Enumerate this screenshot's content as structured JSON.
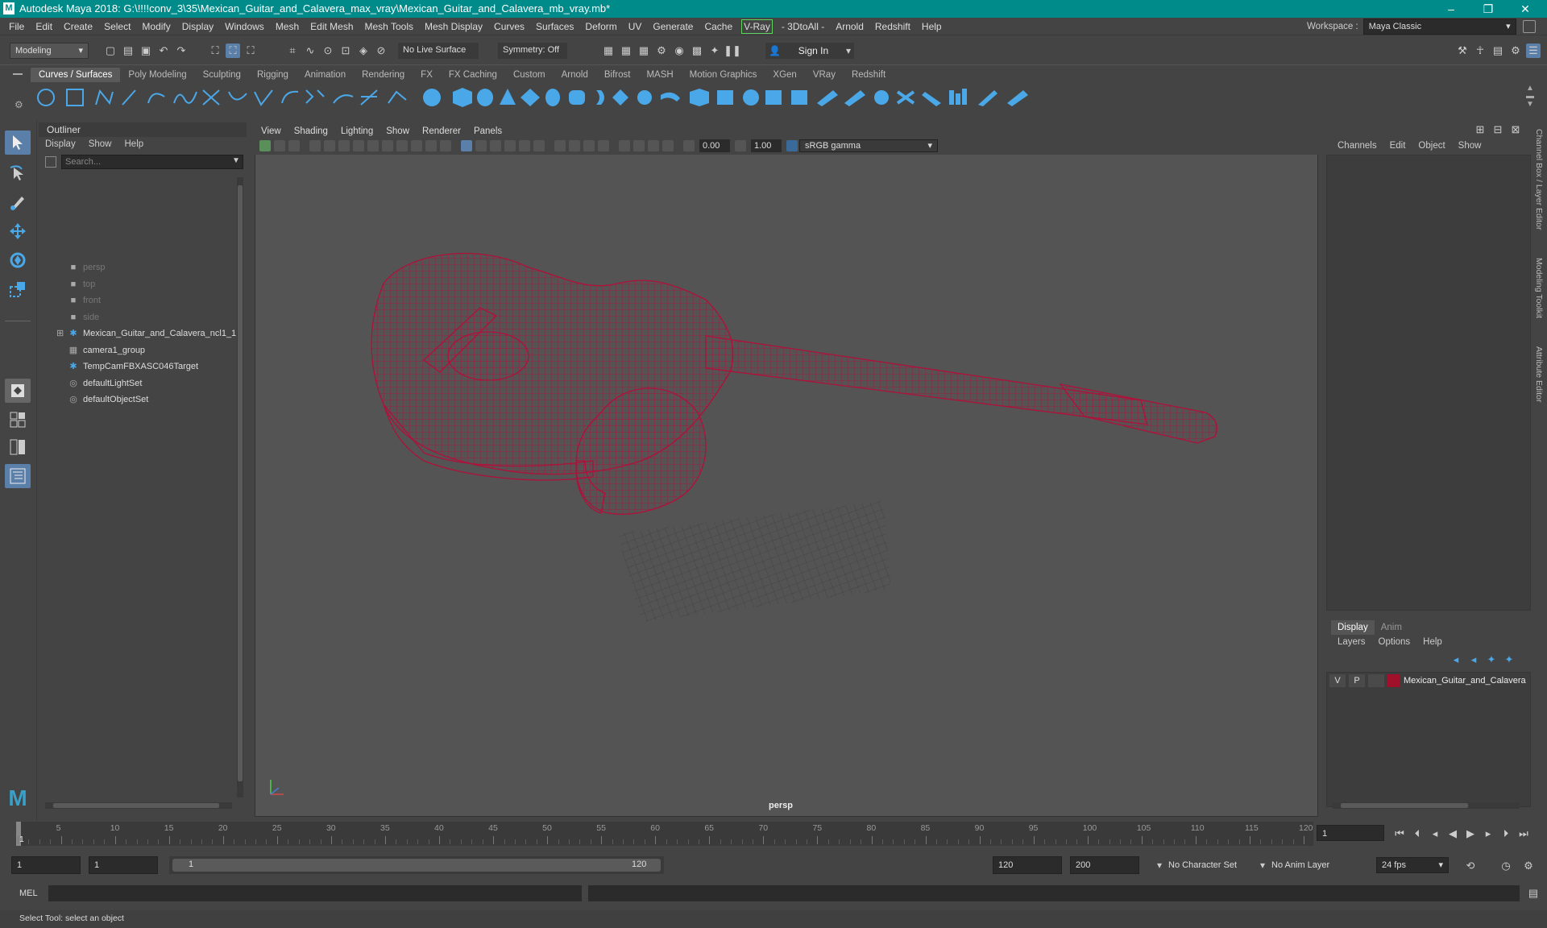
{
  "app": {
    "title": "Autodesk Maya 2018: G:\\!!!!conv_3\\35\\Mexican_Guitar_and_Calavera_max_vray\\Mexican_Guitar_and_Calavera_mb_vray.mb*",
    "logo_text": "M",
    "minimize": "–",
    "restore": "❐",
    "close": "✕"
  },
  "menubar": [
    "File",
    "Edit",
    "Create",
    "Select",
    "Modify",
    "Display",
    "Windows",
    "Mesh",
    "Edit Mesh",
    "Mesh Tools",
    "Mesh Display",
    "Curves",
    "Surfaces",
    "Deform",
    "UV",
    "Generate",
    "Cache",
    "V-Ray",
    "- 3DtoAll -",
    "Arnold",
    "Redshift",
    "Help"
  ],
  "workspace": {
    "label": "Workspace :",
    "value": "Maya Classic"
  },
  "statusline": {
    "mode": "Modeling",
    "live_surface": "No Live Surface",
    "symmetry": "Symmetry: Off",
    "sign_in": "Sign In"
  },
  "shelf_tabs": [
    "Curves / Surfaces",
    "Poly Modeling",
    "Sculpting",
    "Rigging",
    "Animation",
    "Rendering",
    "FX",
    "FX Caching",
    "Custom",
    "Arnold",
    "Bifrost",
    "MASH",
    "Motion Graphics",
    "XGen",
    "VRay",
    "Redshift"
  ],
  "shelf_active": "Curves / Surfaces",
  "outliner": {
    "title": "Outliner",
    "menus": [
      "Display",
      "Show",
      "Help"
    ],
    "search_placeholder": "Search...",
    "items": [
      {
        "label": "persp",
        "icon": "camera-icon",
        "dim": true
      },
      {
        "label": "top",
        "icon": "camera-icon",
        "dim": true
      },
      {
        "label": "front",
        "icon": "camera-icon",
        "dim": true
      },
      {
        "label": "side",
        "icon": "camera-icon",
        "dim": true
      },
      {
        "label": "Mexican_Guitar_and_Calavera_ncl1_1",
        "icon": "locator-icon",
        "dim": false,
        "expandable": true
      },
      {
        "label": "camera1_group",
        "icon": "group-icon",
        "dim": false
      },
      {
        "label": "TempCamFBXASC046Target",
        "icon": "locator-icon",
        "dim": false
      },
      {
        "label": "defaultLightSet",
        "icon": "set-icon",
        "dim": false
      },
      {
        "label": "defaultObjectSet",
        "icon": "set-icon",
        "dim": false
      }
    ]
  },
  "viewport": {
    "menus": [
      "View",
      "Shading",
      "Lighting",
      "Show",
      "Renderer",
      "Panels"
    ],
    "exposure": "0.00",
    "gamma": "1.00",
    "colorspace": "sRGB gamma",
    "camera_label": "persp",
    "wire_color": "#b0103a"
  },
  "channel_box": {
    "menus": [
      "Channels",
      "Edit",
      "Object",
      "Show"
    ]
  },
  "side_tabs": [
    "Channel Box / Layer Editor",
    "Modeling Toolkit",
    "Attribute Editor"
  ],
  "layer_editor": {
    "tabs": [
      "Display",
      "Anim"
    ],
    "active_tab": "Display",
    "menus": [
      "Layers",
      "Options",
      "Help"
    ],
    "layer": {
      "v": "V",
      "p": "P",
      "name": "Mexican_Guitar_and_Calavera",
      "color": "#a0102a"
    }
  },
  "timeline": {
    "ticks": [
      "1",
      "5",
      "10",
      "15",
      "20",
      "25",
      "30",
      "35",
      "40",
      "45",
      "50",
      "55",
      "60",
      "65",
      "70",
      "75",
      "80",
      "85",
      "90",
      "95",
      "100",
      "105",
      "110",
      "115",
      "120"
    ],
    "current_frame": "1"
  },
  "range": {
    "start": "1",
    "playback_start": "1",
    "range_start": "1",
    "range_end": "120",
    "playback_end": "120",
    "end": "200",
    "character_set": "No Character Set",
    "anim_layer": "No Anim Layer",
    "fps": "24 fps"
  },
  "mel": {
    "label": "MEL"
  },
  "helpline": "Select Tool: select an object"
}
